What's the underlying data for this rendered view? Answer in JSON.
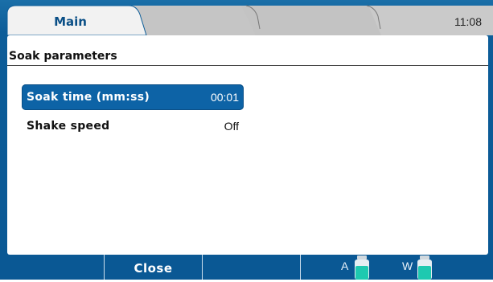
{
  "header": {
    "tabs": [
      {
        "label": "Main",
        "active": true
      },
      {
        "label": "",
        "active": false
      },
      {
        "label": "",
        "active": false
      }
    ],
    "time": "11:08"
  },
  "main": {
    "section_title": "Soak parameters",
    "rows": [
      {
        "label": "Soak time (mm:ss)",
        "value": "00:01",
        "selected": true
      },
      {
        "label": "Shake speed",
        "value": "Off",
        "selected": false
      }
    ]
  },
  "footer": {
    "softkeys": [
      "",
      "Close",
      ""
    ],
    "bottles": [
      {
        "label": "A",
        "icon": "bottle-icon"
      },
      {
        "label": "W",
        "icon": "bottle-icon"
      }
    ]
  },
  "colors": {
    "accent": "#0d63a6",
    "tab_active_text": "#0a4f86",
    "liquid": "#1ec9b0"
  }
}
